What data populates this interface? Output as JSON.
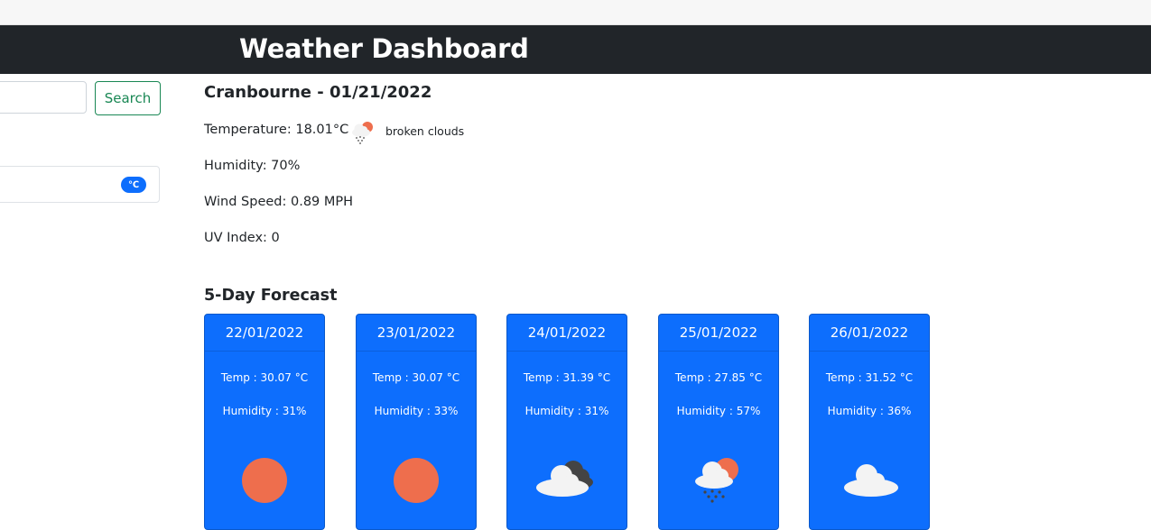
{
  "navbar": {
    "title": "Weather Dashboard"
  },
  "search": {
    "placeholder": "",
    "button_label": "Search"
  },
  "unit_toggle": {
    "label": "℃"
  },
  "current": {
    "heading": "Cranbourne - 01/21/2022",
    "temperature": "Temperature: 18.01°C",
    "description": "broken clouds",
    "icon": "rain-sun-cloud-icon",
    "humidity": "Humidity: 70%",
    "wind": "Wind Speed: 0.89 MPH",
    "uv": "UV Index: 0"
  },
  "forecast": {
    "heading": "5-Day Forecast",
    "days": [
      {
        "date": "22/01/2022",
        "temp": "Temp : 30.07 °C",
        "humidity": "Humidity : 31%",
        "icon": "sun-icon"
      },
      {
        "date": "23/01/2022",
        "temp": "Temp : 30.07 °C",
        "humidity": "Humidity : 33%",
        "icon": "sun-icon"
      },
      {
        "date": "24/01/2022",
        "temp": "Temp : 31.39 °C",
        "humidity": "Humidity : 31%",
        "icon": "dark-clouds-icon"
      },
      {
        "date": "25/01/2022",
        "temp": "Temp : 27.85 °C",
        "humidity": "Humidity : 57%",
        "icon": "rain-sun-cloud-icon"
      },
      {
        "date": "26/01/2022",
        "temp": "Temp : 31.52 °C",
        "humidity": "Humidity : 36%",
        "icon": "cloud-icon"
      }
    ]
  },
  "colors": {
    "navbar_bg": "#212529",
    "card_bg": "#0d6efd",
    "accent_green": "#198754",
    "sun": "#ee6e4d",
    "cloud": "#f3f3f3",
    "dark_cloud": "#444444"
  }
}
